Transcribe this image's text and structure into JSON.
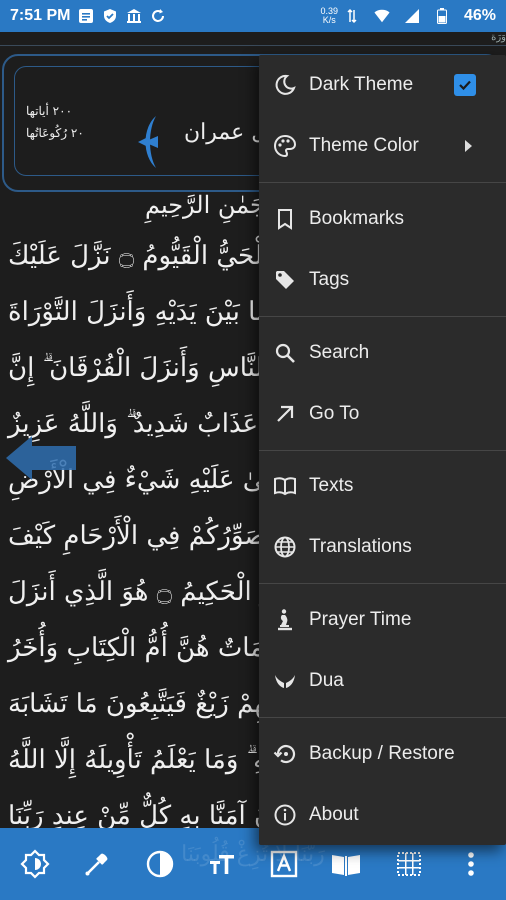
{
  "status_bar": {
    "time": "7:51 PM",
    "net_speed_value": "0.39",
    "net_speed_unit": "K/s",
    "battery": "46%"
  },
  "sura": {
    "name": "ل عمران",
    "ayah_count": "٢٠٠ أياتها",
    "ruku_count": "٢٠ رُكُوعَاتُها",
    "top_strip": "وَرَة"
  },
  "verses": [
    "جَمٰنِ الرَّحِيمِ",
    "الْحَيُّ الْقَيُّومُ ۝ نَزَّلَ عَلَيْكَ",
    "ما بَيْنَ يَدَيْهِ وَأَنزَلَ التَّوْرَاةَ",
    "لِلنَّاسِ وَأَنزَلَ الْفُرْقَانَ ۗ إِنَّ",
    "مْ عَذَابٌ شَدِيدٌ ۗ وَاللَّهُ عَزِيزٌ",
    "يَخْفَىٰ عَلَيْهِ شَيْءٌ فِي الْأَرْضِ",
    "يُصَوِّرُكُمْ فِي الْأَرْحَامِ كَيْفَ",
    "زُ الْحَكِيمُ ۝ هُوَ الَّذِي أَنزَلَ",
    "حْكَمَاتٌ هُنَّ أُمُّ الْكِتَابِ وَأُخَرُ",
    "لُوبِهِمْ زَيْغٌ فَيَتَّبِعُونَ مَا تَشَابَهَ",
    "وِيلِهِ ۗ وَمَا يَعْلَمُ تَأْوِيلَهُ إِلَّا اللَّهُ",
    "ونَ آمَنَّا بِهِ كُلٌّ مِّنْ عِندِ رَبِّنَا"
  ],
  "faded_bottom_text": "رَبَّنَا لَا تُزِغْ قُلُوبَنَا",
  "menu": {
    "items": [
      {
        "label": "Dark Theme",
        "icon": "moon-icon",
        "checked": true
      },
      {
        "label": "Theme Color",
        "icon": "palette-icon",
        "has_submenu": true
      },
      {
        "label": "Bookmarks",
        "icon": "bookmark-icon"
      },
      {
        "label": "Tags",
        "icon": "tag-icon"
      },
      {
        "label": "Search",
        "icon": "search-icon"
      },
      {
        "label": "Go To",
        "icon": "arrow-up-right-icon"
      },
      {
        "label": "Texts",
        "icon": "book-open-icon"
      },
      {
        "label": "Translations",
        "icon": "globe-icon"
      },
      {
        "label": "Prayer Time",
        "icon": "prayer-icon"
      },
      {
        "label": "Dua",
        "icon": "hands-icon"
      },
      {
        "label": "Backup / Restore",
        "icon": "restore-icon"
      },
      {
        "label": "About",
        "icon": "info-icon"
      }
    ]
  },
  "toolbar": {
    "icons": [
      "brightness-icon",
      "eyedropper-icon",
      "contrast-icon",
      "text-size-icon",
      "font-icon",
      "reading-mode-icon",
      "grid-icon",
      "more-icon"
    ]
  },
  "colors": {
    "accent": "#2a79c4",
    "menu_bg": "#2b2b2b",
    "page_bg": "#1d1d1d",
    "checkbox": "#2f8fe8"
  }
}
